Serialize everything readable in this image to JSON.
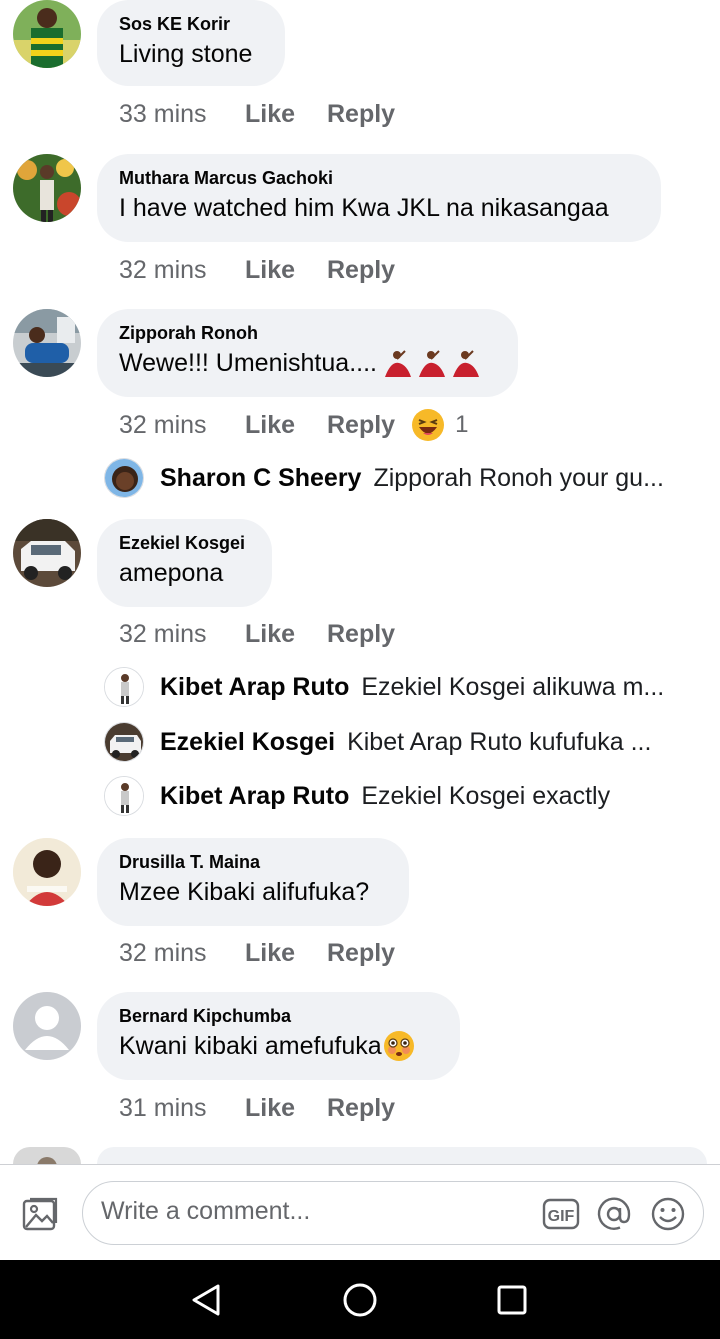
{
  "comments": [
    {
      "name": "Sos KE Korir",
      "text": "Living stone",
      "time": "33 mins",
      "like": "Like",
      "reply": "Reply"
    },
    {
      "name": "Muthara Marcus Gachoki",
      "text": "I have watched him Kwa JKL na nikasangaa",
      "time": "32 mins",
      "like": "Like",
      "reply": "Reply"
    },
    {
      "name": "Zipporah Ronoh",
      "text": "Wewe!!! Umenishtua....",
      "time": "32 mins",
      "like": "Like",
      "reply": "Reply",
      "reaction_count": "1",
      "replies": [
        {
          "name": "Sharon C Sheery",
          "text": "Zipporah Ronoh your gu..."
        }
      ]
    },
    {
      "name": "Ezekiel Kosgei",
      "text": "amepona",
      "time": "32 mins",
      "like": "Like",
      "reply": "Reply",
      "replies": [
        {
          "name": "Kibet Arap Ruto",
          "text": "Ezekiel Kosgei alikuwa m..."
        },
        {
          "name": "Ezekiel Kosgei",
          "text": "Kibet Arap Ruto kufufuka ..."
        },
        {
          "name": "Kibet Arap Ruto",
          "text": "Ezekiel Kosgei exactly"
        }
      ]
    },
    {
      "name": "Drusilla T. Maina",
      "text": "Mzee Kibaki alifufuka?",
      "time": "32 mins",
      "like": "Like",
      "reply": "Reply"
    },
    {
      "name": "Bernard Kipchumba",
      "text": "Kwani kibaki amefufuka",
      "time": "31 mins",
      "like": "Like",
      "reply": "Reply"
    }
  ],
  "composer": {
    "placeholder": "Write a comment...",
    "gif_label": "GIF",
    "icons": [
      "photo-icon",
      "gif-icon",
      "mention-icon",
      "emoji-icon"
    ]
  },
  "nav": {
    "icons": [
      "back-icon",
      "home-icon",
      "recents-icon"
    ]
  },
  "colors": {
    "bubble": "#f0f2f5",
    "meta": "#65676b",
    "text": "#050505",
    "nav_bg": "#000000"
  }
}
